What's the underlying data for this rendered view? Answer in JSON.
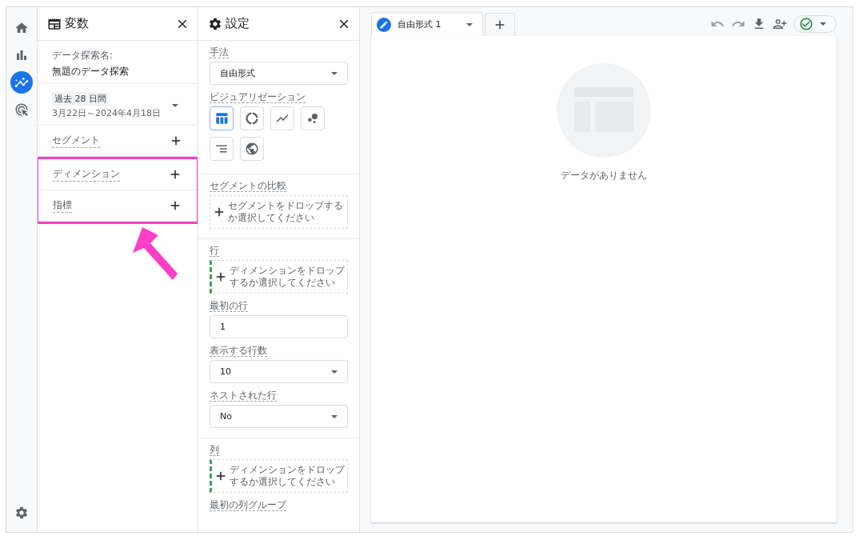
{
  "nav": [
    {
      "kind": "home",
      "selected": false
    },
    {
      "kind": "reports",
      "selected": false
    },
    {
      "kind": "explore",
      "selected": true
    },
    {
      "kind": "advertising",
      "selected": false
    }
  ],
  "variables": {
    "title": "変数",
    "explore_name_label": "データ探索名:",
    "explore_name": "無題のデータ探索",
    "date_range_chip": "過去 28 日間",
    "date_range": "3月22日～2024年4月18日",
    "rows": [
      {
        "label": "セグメント",
        "highlighted": false
      },
      {
        "label": "ディメンション",
        "highlighted": true
      },
      {
        "label": "指標",
        "highlighted": true
      }
    ]
  },
  "settings": {
    "title": "設定",
    "technique_label": "手法",
    "technique": "自由形式",
    "visualization_label": "ビジュアリゼーション",
    "visualizations": [
      {
        "kind": "table",
        "selected": true
      },
      {
        "kind": "donut",
        "selected": false
      },
      {
        "kind": "line",
        "selected": false
      },
      {
        "kind": "scatter",
        "selected": false
      },
      {
        "kind": "bar",
        "selected": false
      },
      {
        "kind": "geo",
        "selected": false
      }
    ],
    "segment_compare_label": "セグメントの比較",
    "segment_drop": "セグメントをドロップするか選択してください",
    "rows_label": "行",
    "rows_drop": "ディメンションをドロップするか選択してください",
    "first_row_label": "最初の行",
    "first_row": "1",
    "show_rows_label": "表示する行数",
    "show_rows": "10",
    "nested_rows_label": "ネストされた行",
    "nested_rows": "No",
    "columns_label": "列",
    "columns_drop": "ディメンションをドロップするか選択してください",
    "first_column_group_label": "最初の列グループ"
  },
  "tabs": [
    {
      "label": "自由形式 1",
      "selected": true
    }
  ],
  "canvas": {
    "empty_message": "データがありません"
  }
}
